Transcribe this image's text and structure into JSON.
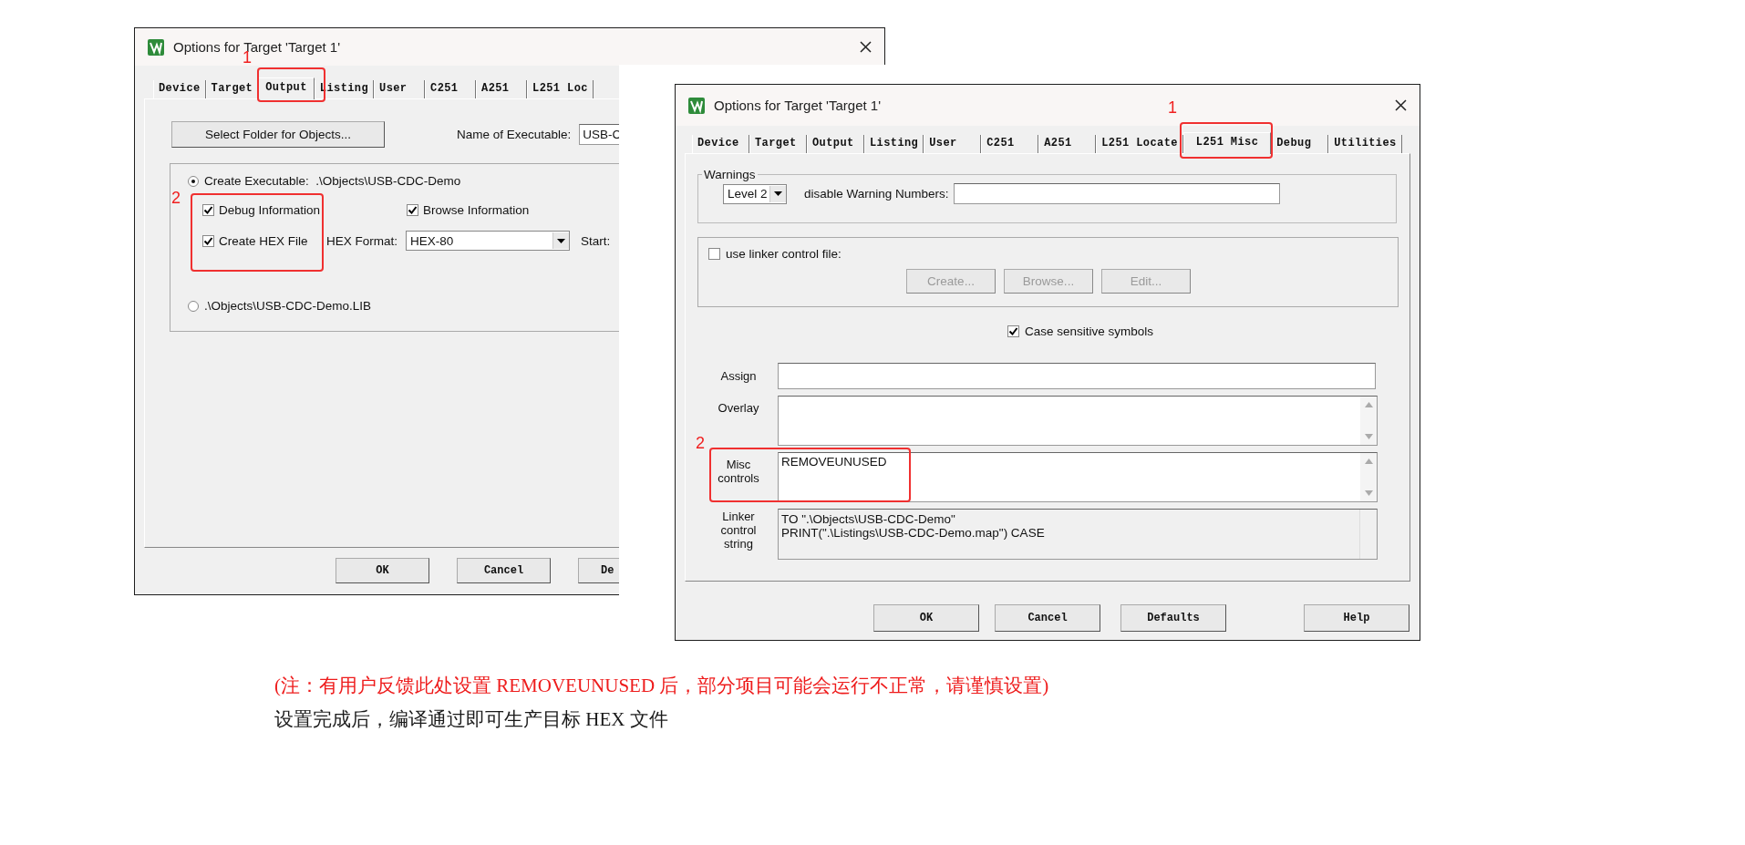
{
  "dialogs": [
    {
      "kind": "output",
      "title": "Options for Target 'Target 1'",
      "tabs": [
        {
          "label": "Device",
          "selected": false
        },
        {
          "label": "Target",
          "selected": false
        },
        {
          "label": "Output",
          "selected": true
        },
        {
          "label": "Listing",
          "selected": false
        },
        {
          "label": "User",
          "selected": false
        },
        {
          "label": "C251",
          "selected": false
        },
        {
          "label": "A251",
          "selected": false
        },
        {
          "label": "L251 Loc",
          "selected": false
        }
      ],
      "select_folder_button": "Select Folder for Objects...",
      "executable_name_label": "Name of Executable:",
      "executable_name_value": "USB-C",
      "output_choices": [
        {
          "label": "Create Executable:  .\\Objects\\USB-CDC-Demo",
          "selected": true
        },
        {
          "label": ".\\Objects\\USB-CDC-Demo.LIB",
          "selected": false
        }
      ],
      "options": [
        {
          "label": "Debug Information",
          "checked": true
        },
        {
          "label": "Browse Information",
          "checked": true
        },
        {
          "label": "Create HEX File",
          "checked": true
        }
      ],
      "hex_format_label": "HEX Format:",
      "hex_format_value": "HEX-80",
      "start_label": "Start:",
      "buttons": [
        "OK",
        "Cancel",
        "De"
      ],
      "annotations": [
        {
          "number": "1"
        },
        {
          "number": "2"
        }
      ]
    },
    {
      "kind": "misc",
      "title": "Options for Target 'Target 1'",
      "tabs": [
        {
          "label": "Device",
          "selected": false
        },
        {
          "label": "Target",
          "selected": false
        },
        {
          "label": "Output",
          "selected": false
        },
        {
          "label": "Listing",
          "selected": false
        },
        {
          "label": "User",
          "selected": false
        },
        {
          "label": "C251",
          "selected": false
        },
        {
          "label": "A251",
          "selected": false
        },
        {
          "label": "L251 Locate",
          "selected": false
        },
        {
          "label": "L251 Misc",
          "selected": true
        },
        {
          "label": "Debug",
          "selected": false
        },
        {
          "label": "Utilities",
          "selected": false
        }
      ],
      "warnings": {
        "title": "Warnings",
        "level": "Level 2",
        "disable_label": "disable Warning Numbers:"
      },
      "linker_file": {
        "label": "use linker control file:",
        "checked": false,
        "buttons": [
          {
            "label": "Create...",
            "disabled": true
          },
          {
            "label": "Browse...",
            "disabled": true
          },
          {
            "label": "Edit...",
            "disabled": true
          }
        ]
      },
      "case_sensitive": {
        "label": "Case sensitive symbols",
        "checked": true
      },
      "fields": [
        {
          "kind": "line",
          "label": "Assign"
        },
        {
          "kind": "memo",
          "label": "Overlay"
        },
        {
          "kind": "memo",
          "label": "Misc controls",
          "value": "REMOVEUNUSED"
        },
        {
          "kind": "readonly",
          "label": "Linker control string",
          "lines": [
            "TO \".\\Objects\\USB-CDC-Demo\"",
            "PRINT(\".\\Listings\\USB-CDC-Demo.map\") CASE"
          ]
        }
      ],
      "buttons": [
        "OK",
        "Cancel",
        "Defaults",
        "Help"
      ],
      "annotations": [
        {
          "number": "1"
        },
        {
          "number": "2"
        }
      ]
    }
  ],
  "notes": [
    {
      "kind": "caution",
      "text": "(注：有用户反馈此处设置 REMOVEUNUSED 后，部分项目可能会运行不正常，请谨慎设置)"
    },
    {
      "kind": "plain",
      "text": "设置完成后，编译通过即可生产目标 HEX 文件"
    }
  ]
}
